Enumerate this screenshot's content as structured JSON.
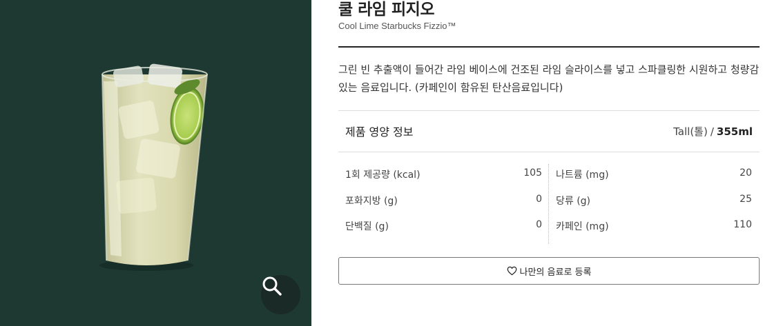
{
  "product": {
    "name_ko": "쿨 라임 피지오",
    "name_en": "Cool Lime Starbucks Fizzio™",
    "description": "그린 빈 추출액이 들어간 라임 베이스에 건조된 라임 슬라이스를 넣고 스파클링한 시원하고 청량감 있는 음료입니다. (카페인이 함유된 탄산음료입니다)"
  },
  "image_panel": {
    "zoom_icon": "search-icon",
    "background_color": "#1e3932"
  },
  "nutrition": {
    "title": "제품 영양 정보",
    "size": "Tall(톨)",
    "slash": "/",
    "volume": "355ml",
    "left": [
      {
        "label": "1회 제공량 (kcal)",
        "value": "105"
      },
      {
        "label": "포화지방 (g)",
        "value": "0"
      },
      {
        "label": "단백질 (g)",
        "value": "0"
      }
    ],
    "right": [
      {
        "label": "나트륨 (mg)",
        "value": "20"
      },
      {
        "label": "당류 (g)",
        "value": "25"
      },
      {
        "label": "카페인 (mg)",
        "value": "110"
      }
    ]
  },
  "register_button": {
    "icon": "heart-icon",
    "label": "나만의 음료로 등록"
  }
}
